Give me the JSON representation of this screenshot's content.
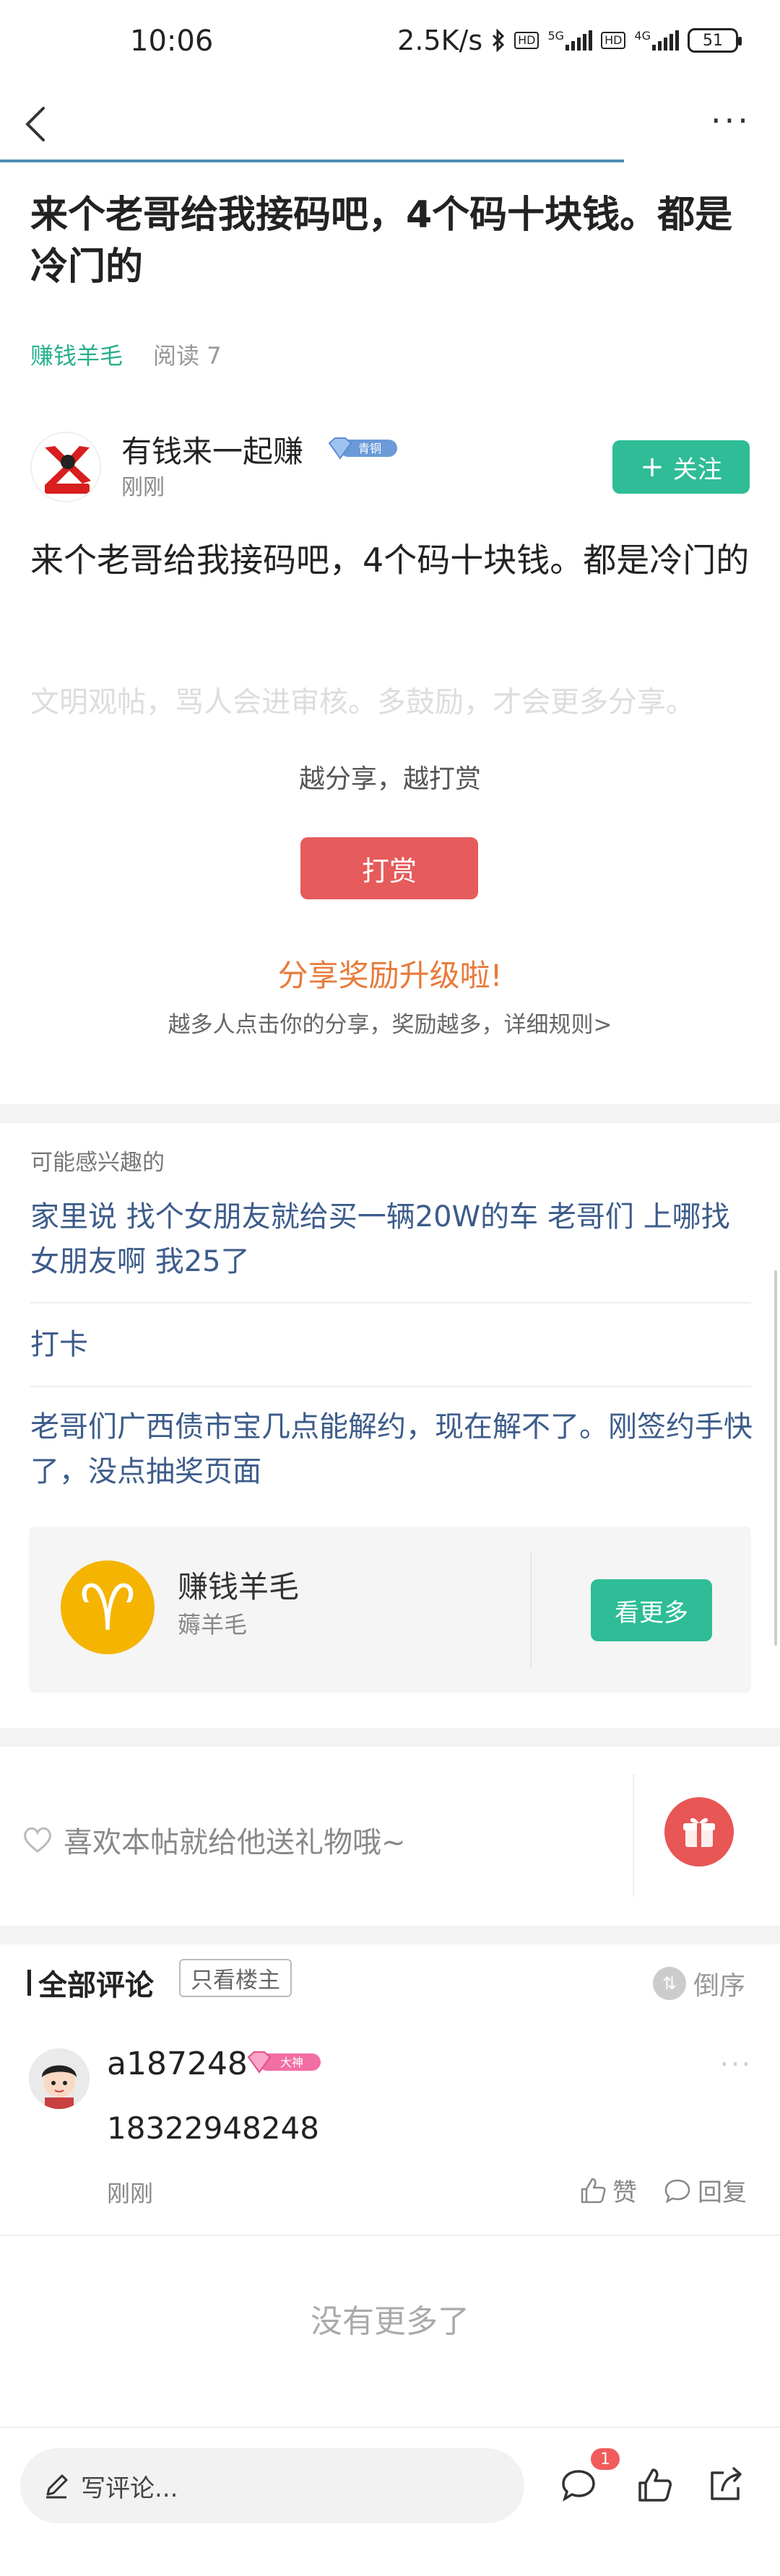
{
  "status_bar": {
    "time": "10:06",
    "network_speed": "2.5K/s",
    "net_5g": "5G",
    "net_4g": "4G",
    "hd": "HD",
    "battery": "51"
  },
  "nav": {
    "back_icon": "chevron-left-icon",
    "more_icon": "more-horizontal-icon",
    "more_label": "···"
  },
  "post": {
    "title": "来个老哥给我接码吧，4个码十块钱。都是冷门的",
    "category": "赚钱羊毛",
    "read_count": "阅读 7",
    "author": {
      "name": "有钱来一起赚",
      "vip_badge": "青铜",
      "time": "刚刚"
    },
    "follow_label": "关注",
    "body": "来个老哥给我接码吧，4个码十块钱。都是冷门的",
    "civility_hint": "文明观帖，骂人会进审核。多鼓励，才会更多分享。"
  },
  "reward": {
    "tagline": "越分享，越打赏",
    "button_label": "打赏",
    "upgrade_title": "分享奖励升级啦!",
    "upgrade_sub": "越多人点击你的分享，奖励越多，详细规则>"
  },
  "related": {
    "heading": "可能感兴趣的",
    "items": [
      {
        "text": "家里说 找个女朋友就给买一辆20W的车 老哥们 上哪找女朋友啊 我25了"
      },
      {
        "text": "打卡"
      },
      {
        "text": "老哥们广西债市宝几点能解约，现在解不了。刚签约手快了，没点抽奖页面"
      }
    ]
  },
  "circle": {
    "logo_glyph": "♈",
    "name": "赚钱羊毛",
    "sub": "薅羊毛",
    "button_label": "看更多"
  },
  "gift": {
    "hint": "喜欢本帖就给他送礼物哦~"
  },
  "comments": {
    "header": "全部评论",
    "only_owner": "只看楼主",
    "reverse": "倒序",
    "items": [
      {
        "name": "a187248",
        "badge": "大神",
        "text": "18322948248",
        "time": "刚刚",
        "like_label": "赞",
        "reply_label": "回复"
      }
    ],
    "no_more": "没有更多了"
  },
  "bottom_bar": {
    "write_placeholder": "写评论...",
    "comment_count": "1"
  },
  "colors": {
    "accent_green": "#2ebd96",
    "reward_red": "#e65b5b",
    "link_blue": "#3d5c8b",
    "orange": "#e87a3a"
  }
}
